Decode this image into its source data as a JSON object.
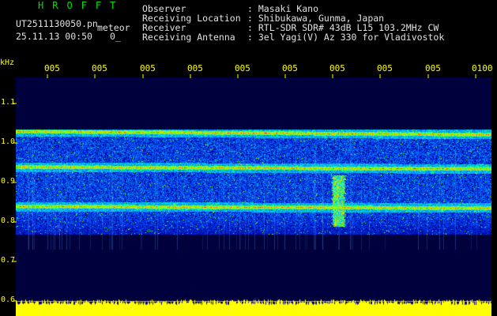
{
  "header": {
    "title": "HROFFT",
    "filename": "UT2511130050.pn",
    "mode": "meteor",
    "datetime": "25.11.13 00:50",
    "counter": "0_",
    "info": [
      {
        "label": "Observer",
        "value": ": Masaki Kano"
      },
      {
        "label": "Receiving Location",
        "value": ": Shibukawa, Gunma, Japan"
      },
      {
        "label": "Receiver",
        "value": ": RTL-SDR SDR# 43dB L15 103.2MHz CW"
      },
      {
        "label": "Receiving Antenna",
        "value": ": 3el Yagi(V) Az 330 for Vladivostok"
      }
    ]
  },
  "axes": {
    "y_unit": "kHz",
    "y_ticks": [
      "1.1",
      "1.0",
      "0.9",
      "0.8",
      "0.7",
      "0.6"
    ],
    "x_ticks": [
      "005",
      "005",
      "005",
      "005",
      "005",
      "005",
      "005",
      "005",
      "005",
      "0100"
    ]
  },
  "colors": {
    "background": "#000000",
    "axis_text": "#ffff00",
    "title": "#00e000",
    "info_text": "#e0e0e0",
    "noise_band": "#ffff00",
    "noise_bg": "#0000a0",
    "divider": "#9a9a9a"
  },
  "chart_data": {
    "type": "heatmap",
    "x_ticks": [
      "005",
      "005",
      "005",
      "005",
      "005",
      "005",
      "005",
      "005",
      "005",
      "0100"
    ],
    "y_unit": "kHz",
    "y_ticks": [
      1.1,
      1.0,
      0.9,
      0.8,
      0.7,
      0.6
    ],
    "ylim": [
      0.6,
      1.1
    ],
    "signal_band_khz": [
      0.77,
      1.03
    ],
    "carrier_lines_khz": [
      1.03,
      0.94,
      0.84
    ],
    "meteor_event_khz": [
      0.79,
      0.92
    ]
  }
}
